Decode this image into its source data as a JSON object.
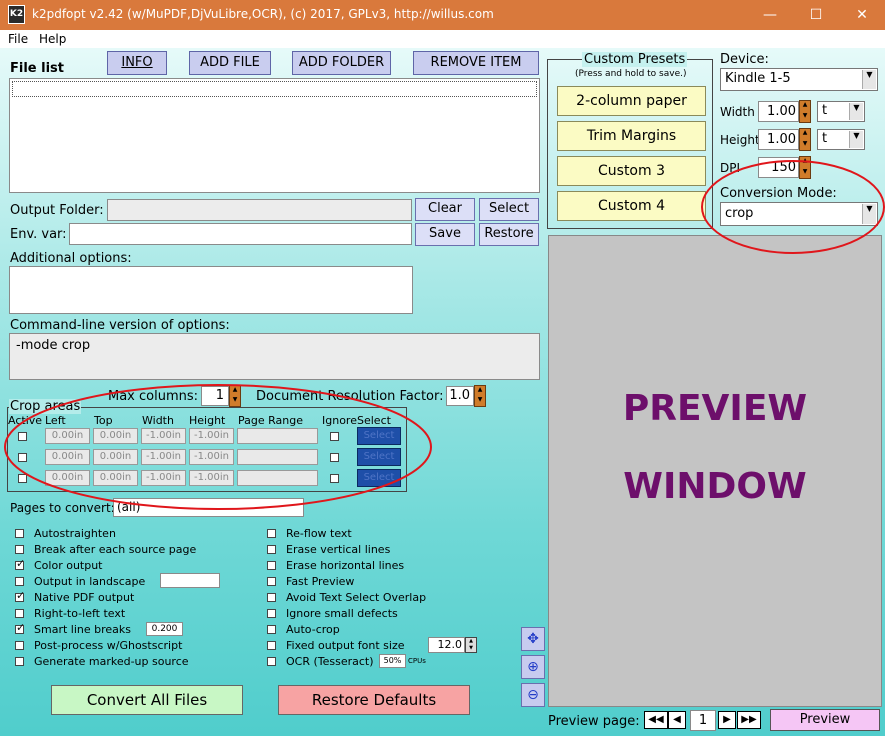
{
  "window": {
    "title": "k2pdfopt v2.42 (w/MuPDF,DjVuLibre,OCR), (c) 2017, GPLv3, http://willus.com",
    "icon_text": "K2"
  },
  "menu": {
    "file": "File",
    "help": "Help"
  },
  "file_list": {
    "label": "File list",
    "buttons": {
      "info": "INFO",
      "add_file": "ADD FILE",
      "add_folder": "ADD FOLDER",
      "remove_item": "REMOVE ITEM"
    }
  },
  "output_folder": {
    "label": "Output Folder:",
    "value": "",
    "clear": "Clear",
    "select": "Select"
  },
  "env_var": {
    "label": "Env. var:",
    "value": "",
    "save": "Save",
    "restore": "Restore"
  },
  "additional_options": {
    "label": "Additional options:",
    "value": ""
  },
  "command_line": {
    "label": "Command-line version of options:",
    "value": "-mode crop"
  },
  "max_columns": {
    "label": "Max columns:",
    "value": "1"
  },
  "doc_resolution": {
    "label": "Document Resolution Factor:",
    "value": "1.0"
  },
  "crop_areas": {
    "title": "Crop areas",
    "headers": {
      "active": "Active",
      "left": "Left",
      "top": "Top",
      "width": "Width",
      "height": "Height",
      "page_range": "Page Range",
      "ignore": "Ignore",
      "select": "Select"
    },
    "rows": [
      {
        "left": "0.00in",
        "top": "0.00in",
        "width": "-1.00in",
        "height": "-1.00in",
        "page_range": "",
        "select": "Select"
      },
      {
        "left": "0.00in",
        "top": "0.00in",
        "width": "-1.00in",
        "height": "-1.00in",
        "page_range": "",
        "select": "Select"
      },
      {
        "left": "0.00in",
        "top": "0.00in",
        "width": "-1.00in",
        "height": "-1.00in",
        "page_range": "",
        "select": "Select"
      }
    ]
  },
  "pages": {
    "label": "Pages to convert:",
    "value": "(all)"
  },
  "options_left": [
    {
      "label": "Autostraighten",
      "checked": false
    },
    {
      "label": "Break after each source page",
      "checked": false
    },
    {
      "label": "Color output",
      "checked": true
    },
    {
      "label": "Output in landscape",
      "checked": false
    },
    {
      "label": "Native PDF output",
      "checked": true
    },
    {
      "label": "Right-to-left text",
      "checked": false
    },
    {
      "label": "Smart line breaks",
      "checked": true
    },
    {
      "label": "Post-process w/Ghostscript",
      "checked": false
    },
    {
      "label": "Generate marked-up source",
      "checked": false
    }
  ],
  "options_right": [
    {
      "label": "Re-flow text",
      "checked": false
    },
    {
      "label": "Erase vertical lines",
      "checked": false
    },
    {
      "label": "Erase horizontal lines",
      "checked": false
    },
    {
      "label": "Fast Preview",
      "checked": false
    },
    {
      "label": "Avoid Text Select Overlap",
      "checked": false
    },
    {
      "label": "Ignore small defects",
      "checked": false
    },
    {
      "label": "Auto-crop",
      "checked": false
    },
    {
      "label": "Fixed output font size",
      "checked": false
    },
    {
      "label": "OCR (Tesseract)",
      "checked": false
    }
  ],
  "landscape_value": "",
  "smart_line_value": "0.200",
  "font_size_value": "12.0",
  "ocr": {
    "value": "50%",
    "cpus": "CPUs"
  },
  "presets": {
    "title": "Custom Presets",
    "subtitle": "(Press and hold to save.)",
    "items": [
      "2-column paper",
      "Trim Margins",
      "Custom 3",
      "Custom 4"
    ]
  },
  "device": {
    "label": "Device:",
    "value": "Kindle 1-5"
  },
  "width": {
    "label": "Width",
    "value": "1.00",
    "unit": "t"
  },
  "height": {
    "label": "Height",
    "value": "1.00",
    "unit": "t"
  },
  "dpi": {
    "label": "DPI",
    "value": "150"
  },
  "conversion_mode": {
    "label": "Conversion Mode:",
    "value": "crop"
  },
  "preview": {
    "line1": "PREVIEW",
    "line2": "WINDOW",
    "page_label": "Preview page:",
    "page_value": "1",
    "button": "Preview"
  },
  "actions": {
    "convert": "Convert All Files",
    "restore": "Restore Defaults"
  },
  "colors": {
    "titlebar": "#d9793c",
    "annotation": "#e0161b",
    "preview_text": "#6d0f6b",
    "convert_bg": "#c8f7c5",
    "restore_bg": "#f7a3a3",
    "preset_bg": "#fbfbc4"
  }
}
